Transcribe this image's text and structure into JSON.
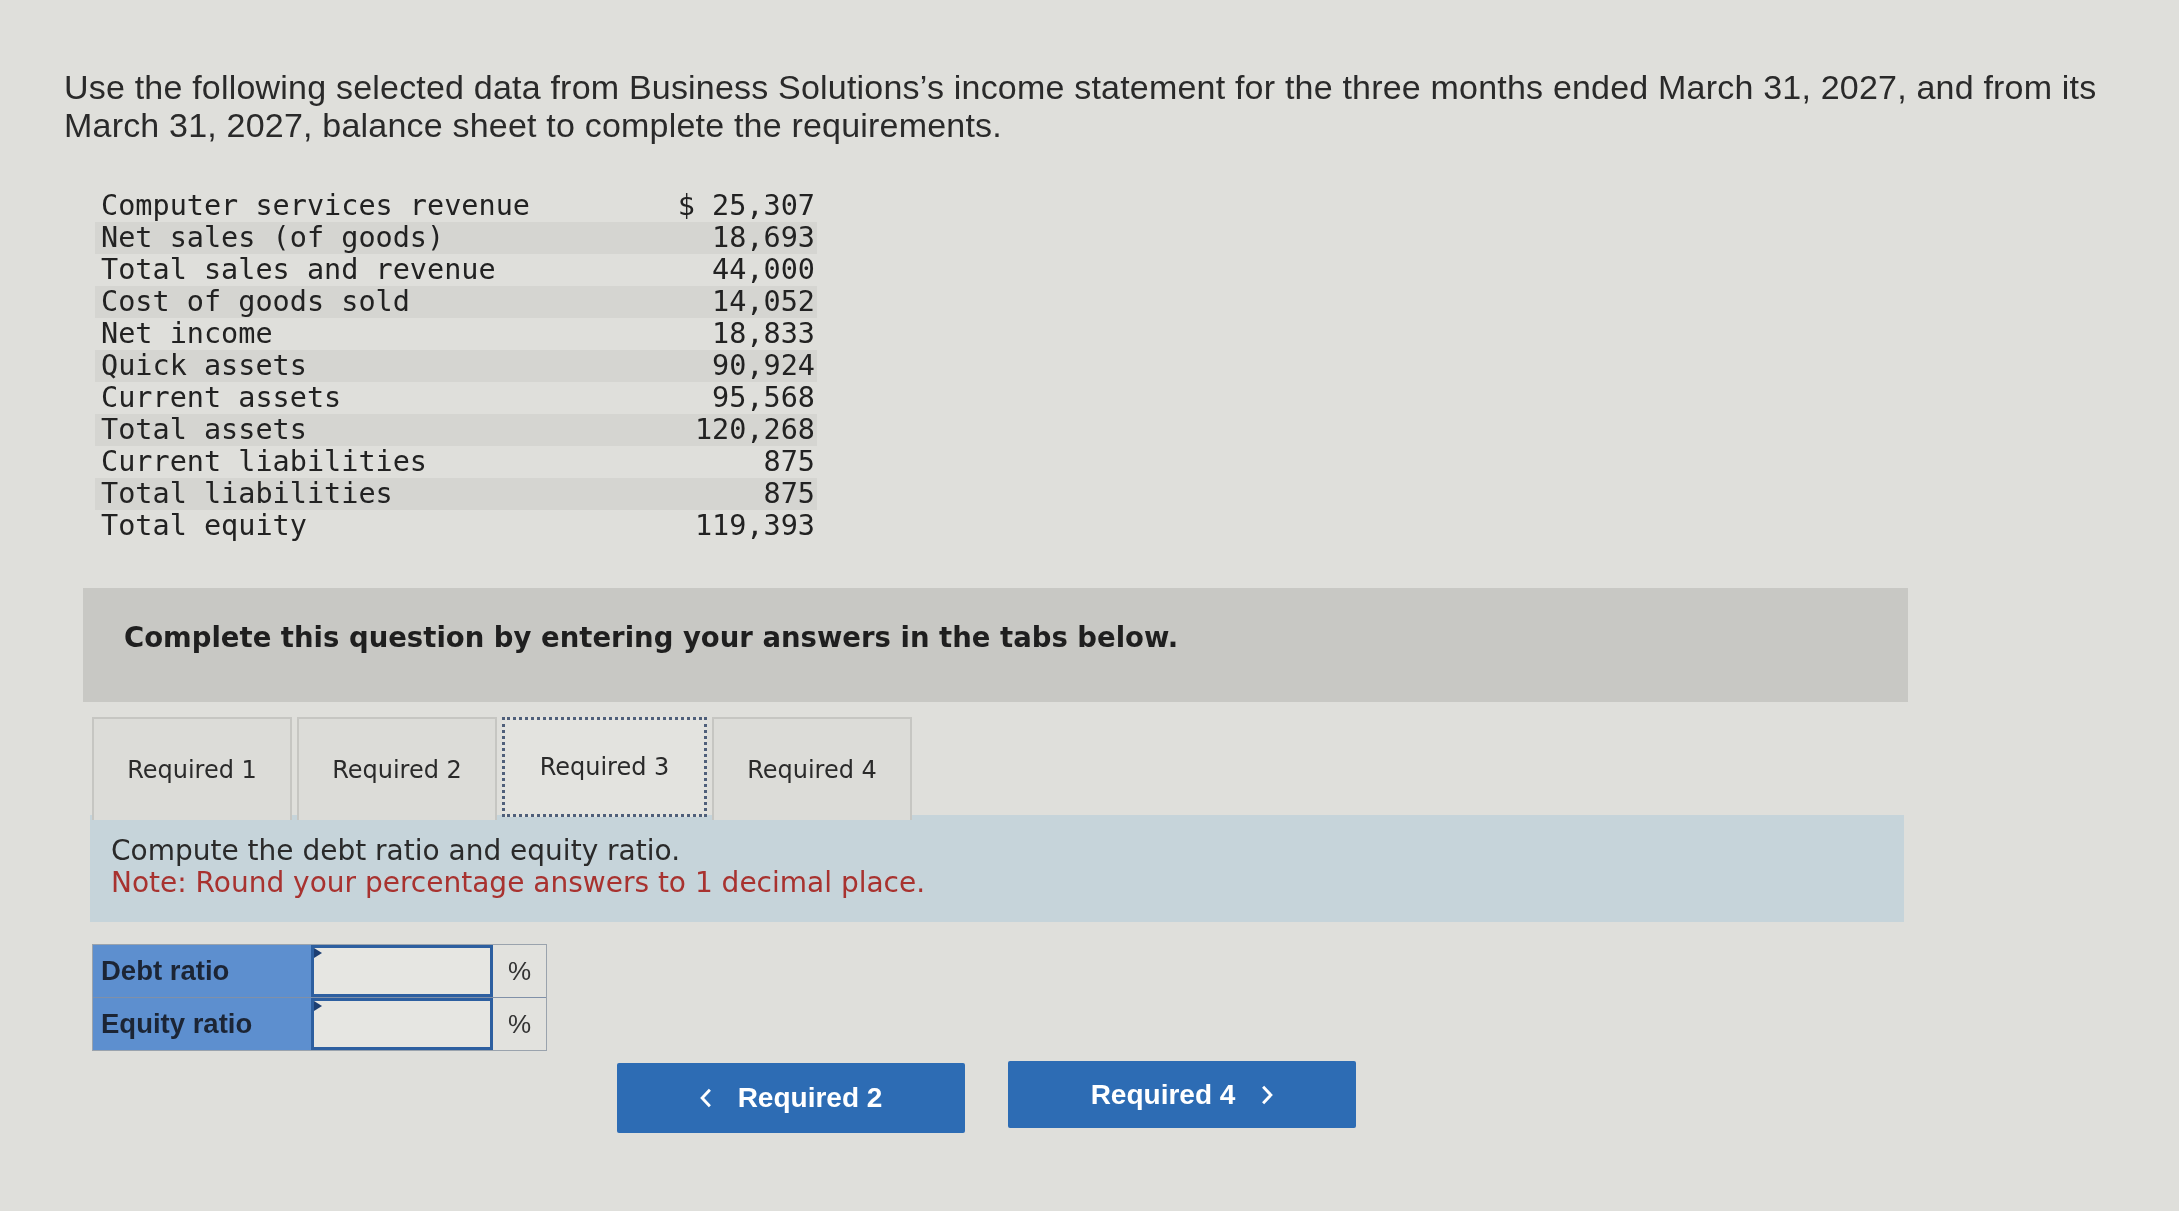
{
  "intro": "Use the following selected data from Business Solutions’s income statement for the three months ended March 31, 2027, and from its March 31, 2027, balance sheet to complete the requirements.",
  "data_rows": [
    {
      "label": "Computer services revenue",
      "value": "$ 25,307"
    },
    {
      "label": "Net sales (of goods)",
      "value": "18,693"
    },
    {
      "label": "Total sales and revenue",
      "value": "44,000"
    },
    {
      "label": "Cost of goods sold",
      "value": "14,052"
    },
    {
      "label": "Net income",
      "value": "18,833"
    },
    {
      "label": "Quick assets",
      "value": "90,924"
    },
    {
      "label": "Current assets",
      "value": "95,568"
    },
    {
      "label": "Total assets",
      "value": "120,268"
    },
    {
      "label": "Current liabilities",
      "value": "875"
    },
    {
      "label": "Total liabilities",
      "value": "875"
    },
    {
      "label": "Total equity",
      "value": "119,393"
    }
  ],
  "banner": "Complete this question by entering your answers in the tabs below.",
  "tabs": [
    {
      "label": "Required 1",
      "selected": false
    },
    {
      "label": "Required 2",
      "selected": false
    },
    {
      "label": "Required 3",
      "selected": true
    },
    {
      "label": "Required 4",
      "selected": false
    }
  ],
  "instructions": {
    "text": "Compute the debt ratio and equity ratio.",
    "note": "Note: Round your percentage answers to 1 decimal place."
  },
  "answers": [
    {
      "label": "Debt ratio",
      "unit": "%"
    },
    {
      "label": "Equity ratio",
      "unit": "%"
    }
  ],
  "nav_buttons": [
    {
      "kind": "prev",
      "label": "Required 2"
    },
    {
      "kind": "next",
      "label": "Required 4"
    }
  ]
}
